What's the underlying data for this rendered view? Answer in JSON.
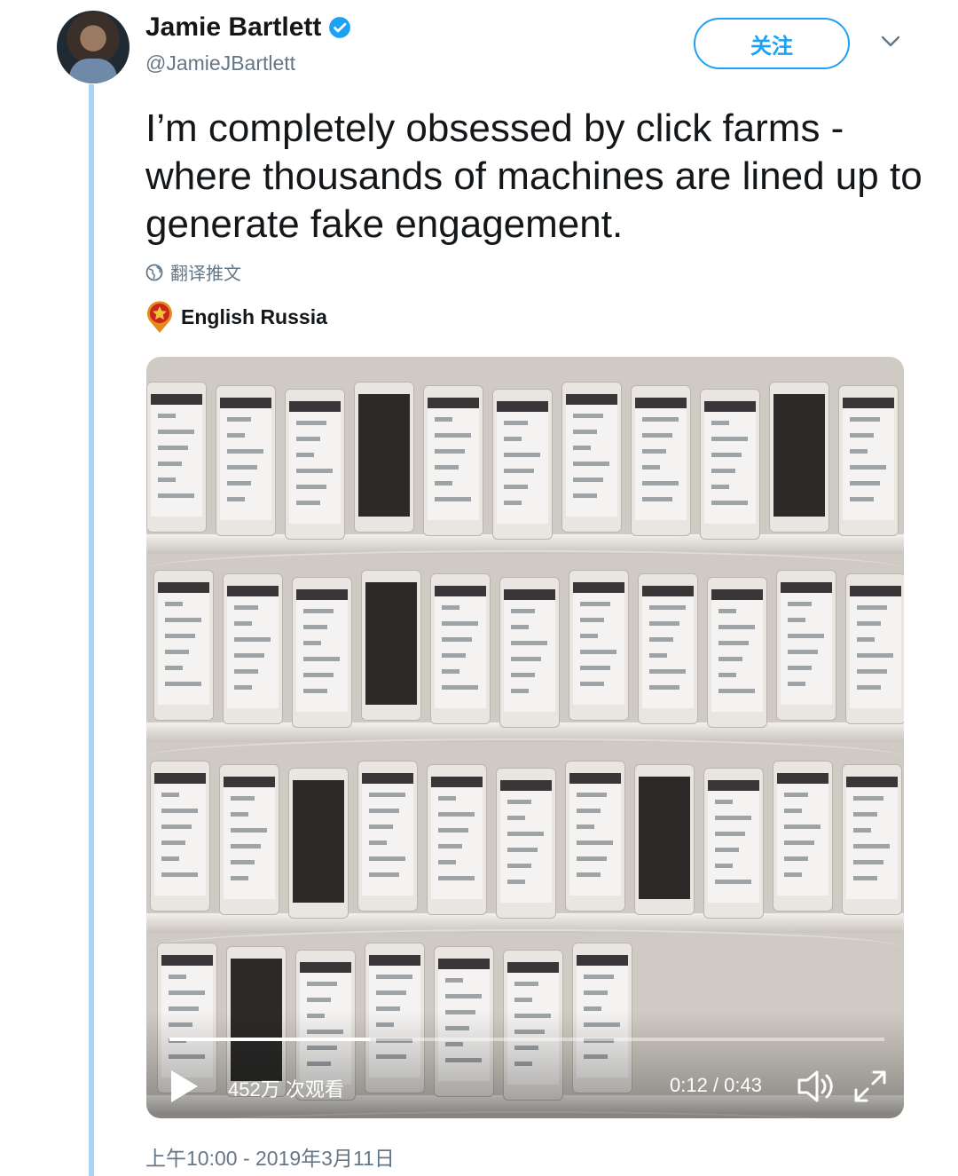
{
  "author": {
    "name": "Jamie Bartlett",
    "handle": "@JamieJBartlett",
    "verified": true
  },
  "actions": {
    "follow_label": "关注"
  },
  "tweet": {
    "text": "I’m completely obsessed by click farms - where thousands of machines are lined up to generate fake engagement.",
    "translate_label": "翻译推文"
  },
  "media_source": {
    "name": "English Russia"
  },
  "video": {
    "views": "452万 次观看",
    "time": "0:12 / 0:43",
    "progress": 0.28
  },
  "timestamp": "上午10:00 - 2019年3月11日",
  "colors": {
    "accent": "#1da1f2",
    "secondary_text": "#657786",
    "thread_line": "#a7d3f5"
  },
  "icons": [
    "verified-badge-icon",
    "chevron-down-icon",
    "globe-icon",
    "source-badge-icon",
    "play-icon",
    "volume-icon",
    "fullscreen-icon"
  ]
}
